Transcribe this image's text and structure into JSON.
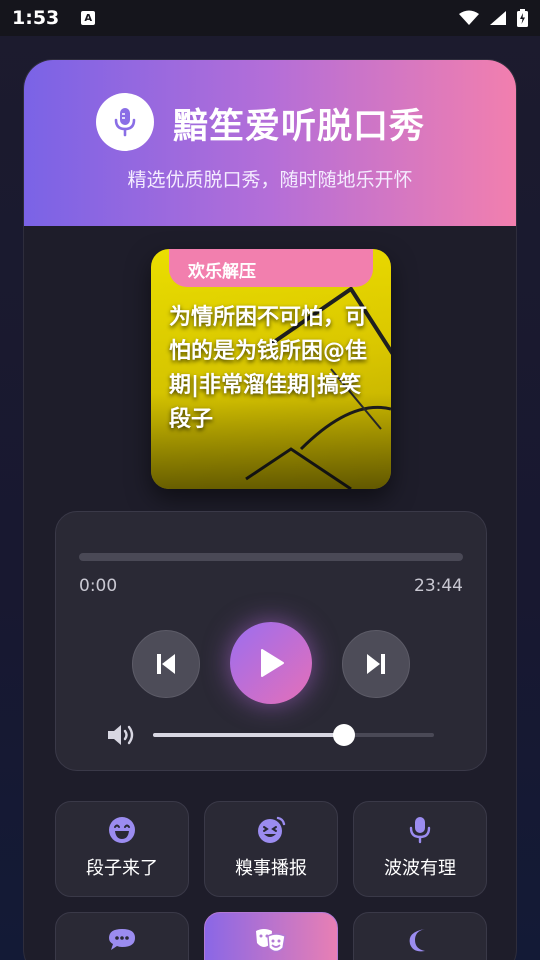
{
  "status_bar": {
    "time": "1:53",
    "notification_letter": "A"
  },
  "app": {
    "title": "黯笙爱听脱口秀",
    "subtitle": "精选优质脱口秀，随时随地乐开怀"
  },
  "cover": {
    "tag": "欢乐解压",
    "title": "为情所困不可怕，可怕的是为钱所困@佳期|非常溜佳期|搞笑段子"
  },
  "player": {
    "current_time": "0:00",
    "total_time": "23:44",
    "progress": 0,
    "volume": 0.68
  },
  "categories": [
    {
      "label": "段子来了",
      "icon": "laugh-icon"
    },
    {
      "label": "糗事播报",
      "icon": "grin-squint-icon"
    },
    {
      "label": "波波有理",
      "icon": "microphone-icon"
    },
    {
      "label": "",
      "icon": "chat-bubble-icon"
    },
    {
      "label": "",
      "icon": "theater-masks-icon",
      "active": true
    },
    {
      "label": "",
      "icon": "moon-icon"
    }
  ],
  "colors": {
    "accent_purple": "#7a63e6",
    "accent_pink": "#f27fae",
    "icon_purple": "#9b8cf0",
    "cover_yellow": "#f7ea00"
  }
}
